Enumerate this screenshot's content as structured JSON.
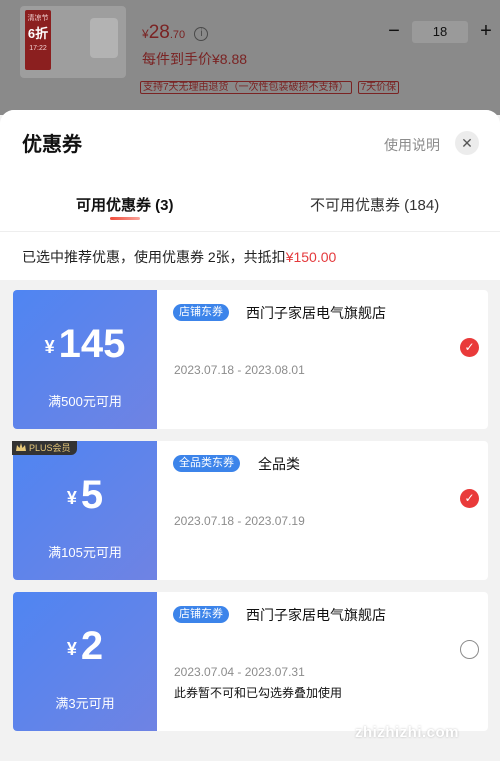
{
  "product": {
    "tag_top": "清凉节",
    "tag_discount": "6折",
    "tag_date": "17:22",
    "price_symbol": "¥",
    "price_int": "28",
    "price_dec": ".70",
    "info_icon": "info-icon",
    "per_unit": "每件到手价¥8.88",
    "policy_return": "支持7天无理由退货（一次性包装破损不支持）",
    "policy_price": "7天价保",
    "quantity": "18",
    "minus_label": "−",
    "plus_label": "+"
  },
  "sheet": {
    "title": "优惠券",
    "help": "使用说明",
    "close_label": "✕",
    "tabs": [
      {
        "label": "可用优惠券 (3)",
        "active": true
      },
      {
        "label": "不可用优惠券 (184)",
        "active": false
      }
    ],
    "summary_prefix": "已选中推荐优惠，使用优惠券 2张，共抵扣",
    "summary_amount": "¥150.00"
  },
  "coupons": [
    {
      "yen": "¥",
      "value": "145",
      "condition": "满500元可用",
      "badge": "店铺东券",
      "name": "西门子家居电气旗舰店",
      "date": "2023.07.18 - 2023.08.01",
      "note": "",
      "checked": true
    },
    {
      "yen": "¥",
      "value": "5",
      "condition": "满105元可用",
      "badge": "全品类东券",
      "name": "全品类",
      "date": "2023.07.18 - 2023.07.19",
      "note": "",
      "checked": true,
      "plus_tag": "PLUS会员"
    },
    {
      "yen": "¥",
      "value": "2",
      "condition": "满3元可用",
      "badge": "店铺东券",
      "name": "西门子家居电气旗舰店",
      "date": "2023.07.04 - 2023.07.31",
      "note": "此券暂不可和已勾选券叠加使用",
      "checked": false
    }
  ],
  "watermark": "zhizhizhi.com",
  "colors": {
    "accent": "#e4393c",
    "coupon_blue": "#5a84ee",
    "badge_blue": "#3c84ea"
  }
}
